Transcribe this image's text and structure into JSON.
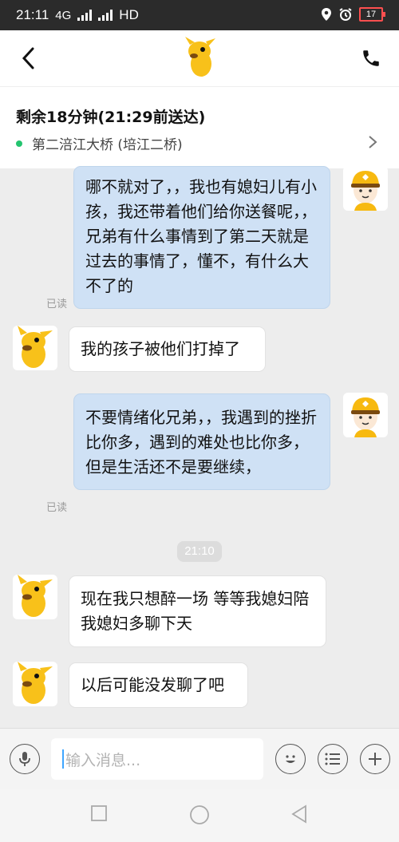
{
  "status": {
    "time": "21:11",
    "network": "HD",
    "battery": "17",
    "net_small": "4G"
  },
  "header": {
    "back": "back-arrow",
    "logo": "kangaroo-logo",
    "call": "phone-icon"
  },
  "delivery": {
    "eta": "剩余18分钟(21:29前送达)",
    "location": "第二涪江大桥 (培江二桥)"
  },
  "messages": [
    {
      "from": "rider",
      "text": "哪不就对了，，我也有媳妇儿有小孩，我还带着他们给你送餐呢，，兄弟有什么事情到了第二天就是过去的事情了，懂不，有什么大不了的",
      "read": "已读"
    },
    {
      "from": "user",
      "text": "我的孩子被他们打掉了"
    },
    {
      "from": "rider",
      "text": "不要情绪化兄弟，，我遇到的挫折比你多，遇到的难处也比你多，但是生活还不是要继续，",
      "read": "已读"
    },
    {
      "from": "system",
      "text": "21:10"
    },
    {
      "from": "user",
      "text": "现在我只想醉一场 等等我媳妇陪我媳妇多聊下天"
    },
    {
      "from": "user",
      "text": "以后可能没发聊了吧"
    }
  ],
  "input": {
    "placeholder": "输入消息..."
  },
  "colors": {
    "rider_bubble": "#cfe1f5",
    "user_bubble": "#ffffff",
    "accent_green": "#24c46f",
    "background": "#ededed"
  }
}
